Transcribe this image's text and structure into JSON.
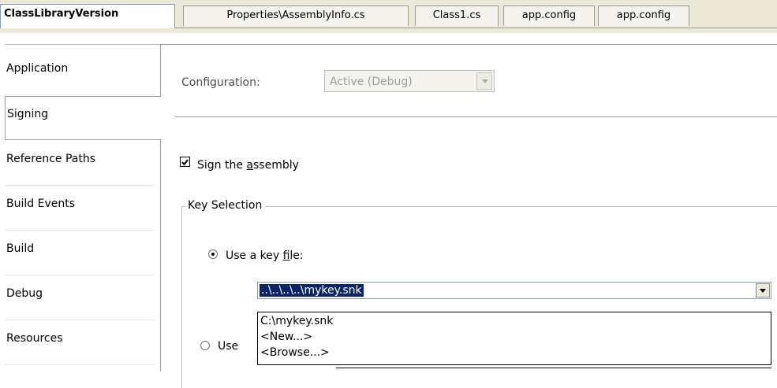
{
  "tabs": [
    {
      "label": "ClassLibraryVersion",
      "active": true
    },
    {
      "label": "Properties\\AssemblyInfo.cs",
      "active": false
    },
    {
      "label": "Class1.cs",
      "active": false
    },
    {
      "label": "app.config",
      "active": false
    },
    {
      "label": "app.config",
      "active": false
    }
  ],
  "nav": {
    "items": [
      {
        "label": "Application"
      },
      {
        "label": "Signing",
        "selected": true
      },
      {
        "label": "Reference Paths"
      },
      {
        "label": "Build Events"
      },
      {
        "label": "Build"
      },
      {
        "label": "Debug"
      },
      {
        "label": "Resources"
      }
    ]
  },
  "config": {
    "label": "Configuration:",
    "value": "Active (Debug)"
  },
  "signing": {
    "checkbox_prefix": "Sign the ",
    "checkbox_mnemonic": "a",
    "checkbox_suffix": "ssembly",
    "checked": true
  },
  "key_selection": {
    "title": "Key Selection",
    "radio_key_file_prefix": "Use a key ",
    "radio_key_file_mnemonic": "f",
    "radio_key_file_suffix": "ile:",
    "radio_key_file_selected": true,
    "radio_other_label": "Use",
    "key_file_value": "..\\..\\..\\..\\mykey.snk",
    "dropdown_options": [
      "C:\\mykey.snk",
      "<New...>",
      "<Browse...>"
    ]
  },
  "colors": {
    "selection": "#0a246a",
    "tab_strip": "#ece9d8"
  }
}
